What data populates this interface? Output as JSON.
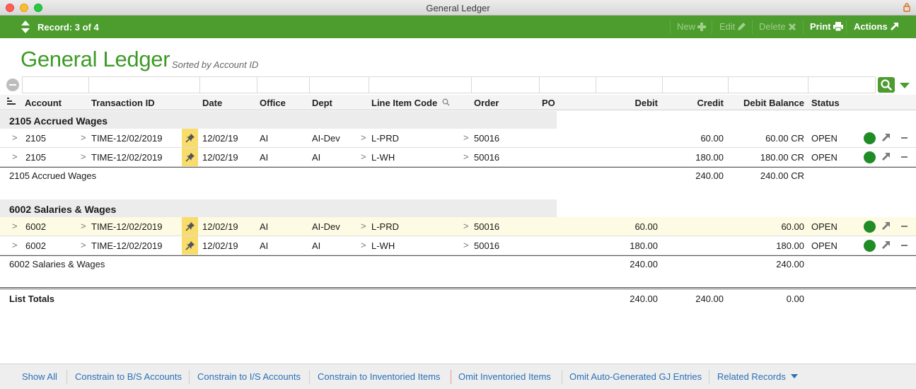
{
  "window": {
    "title": "General Ledger"
  },
  "toolbar": {
    "record": "Record: 3 of 4",
    "new": "New",
    "edit": "Edit",
    "delete": "Delete",
    "print": "Print",
    "actions": "Actions"
  },
  "page": {
    "title": "General Ledger",
    "sort": "Sorted by Account ID"
  },
  "columns": {
    "account": "Account",
    "transaction_id": "Transaction ID",
    "date": "Date",
    "office": "Office",
    "dept": "Dept",
    "line_item_code": "Line Item Code",
    "order": "Order",
    "po": "PO",
    "debit": "Debit",
    "credit": "Credit",
    "debit_balance": "Debit Balance",
    "status": "Status"
  },
  "chevron": ">",
  "groups": [
    {
      "title": "2105 Accrued Wages",
      "rows": [
        {
          "account": "2105",
          "transaction_id": "TIME-12/02/2019",
          "date": "12/02/19",
          "office": "AI",
          "dept": "AI-Dev",
          "line_item_code": "L-PRD",
          "order": "50016",
          "po": "",
          "debit": "",
          "credit": "60.00",
          "debit_balance": "60.00 CR",
          "status": "OPEN"
        },
        {
          "account": "2105",
          "transaction_id": "TIME-12/02/2019",
          "date": "12/02/19",
          "office": "AI",
          "dept": "AI",
          "line_item_code": "L-WH",
          "order": "50016",
          "po": "",
          "debit": "",
          "credit": "180.00",
          "debit_balance": "180.00 CR",
          "status": "OPEN"
        }
      ],
      "subtotal": {
        "label": "2105 Accrued Wages",
        "debit": "",
        "credit": "240.00",
        "debit_balance": "240.00 CR"
      }
    },
    {
      "title": "6002 Salaries & Wages",
      "rows": [
        {
          "account": "6002",
          "transaction_id": "TIME-12/02/2019",
          "date": "12/02/19",
          "office": "AI",
          "dept": "AI-Dev",
          "line_item_code": "L-PRD",
          "order": "50016",
          "po": "",
          "debit": "60.00",
          "credit": "",
          "debit_balance": "60.00",
          "status": "OPEN"
        },
        {
          "account": "6002",
          "transaction_id": "TIME-12/02/2019",
          "date": "12/02/19",
          "office": "AI",
          "dept": "AI",
          "line_item_code": "L-WH",
          "order": "50016",
          "po": "",
          "debit": "180.00",
          "credit": "",
          "debit_balance": "180.00",
          "status": "OPEN"
        }
      ],
      "subtotal": {
        "label": "6002 Salaries & Wages",
        "debit": "240.00",
        "credit": "",
        "debit_balance": "240.00"
      }
    }
  ],
  "totals": {
    "label": "List Totals",
    "debit": "240.00",
    "credit": "240.00",
    "debit_balance": "0.00"
  },
  "footer": {
    "show_all": "Show All",
    "constrain_bs": "Constrain to B/S Accounts",
    "constrain_is": "Constrain to I/S Accounts",
    "constrain_inv": "Constrain to Inventoried Items",
    "omit_inv": "Omit Inventoried Items",
    "omit_auto": "Omit Auto-Generated GJ Entries",
    "related": "Related Records"
  },
  "colors": {
    "accent": "#4c9c2e",
    "title": "#3d9a26",
    "status_open": "#208c25",
    "link": "#2a70b8",
    "pin": "#f8dc6c"
  },
  "icons": [
    "lock-icon",
    "updown-arrows-icon",
    "plus-icon",
    "pencil-icon",
    "x-icon",
    "printer-icon",
    "jump-arrow-icon",
    "column-settings-icon",
    "minus-circle-icon",
    "magnifier-icon",
    "pin-icon",
    "status-dot-icon",
    "chevron-down-icon"
  ]
}
